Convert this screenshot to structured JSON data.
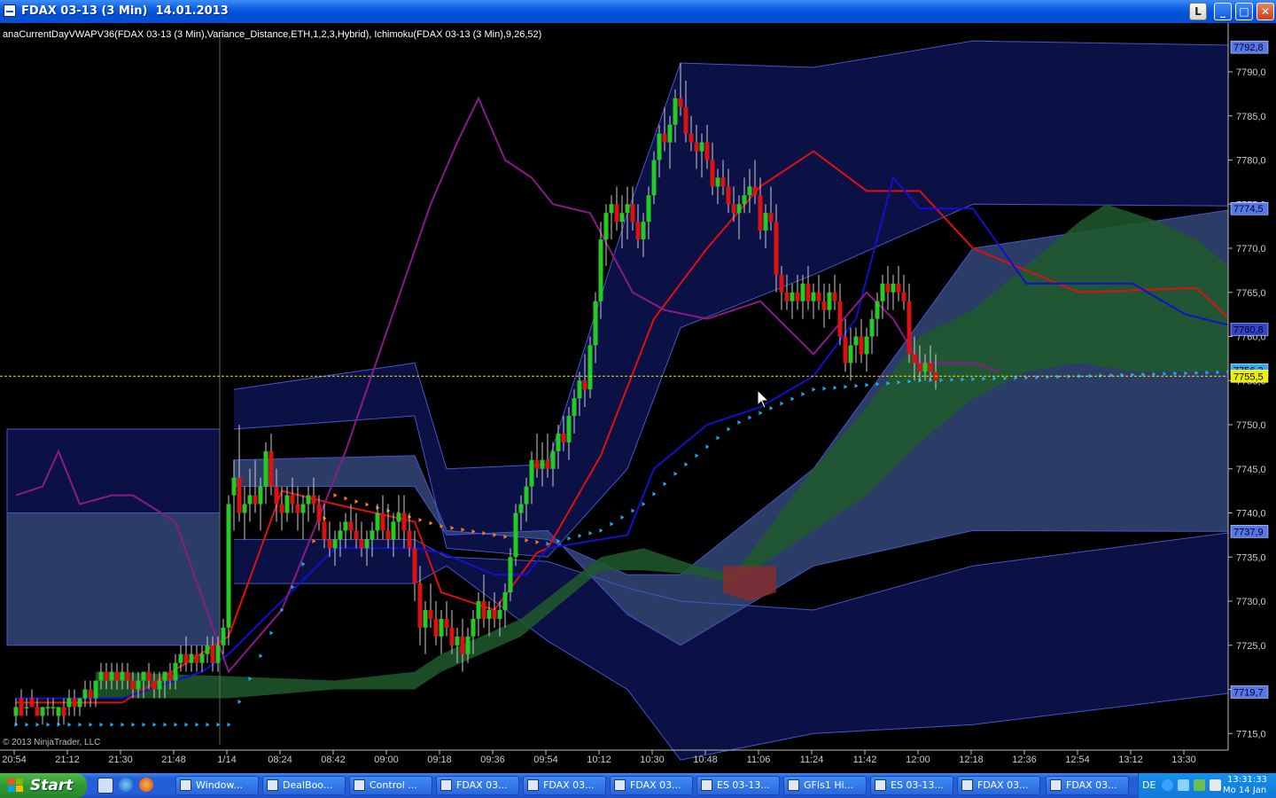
{
  "window": {
    "title": "FDAX 03-13 (3 Min)  14.01.2013",
    "buttons": {
      "link": "L",
      "minimize": "_",
      "maximize": "□",
      "close": "✕"
    }
  },
  "indicator_caption": "anaCurrentDayVWAPV36(FDAX 03-13 (3 Min),Variance_Distance,ETH,1,2,3,Hybrid),  Ichimoku(FDAX 03-13 (3 Min),9,26,52)",
  "copyright": "© 2013 NinjaTrader, LLC",
  "colors": {
    "background": "#000000",
    "vwap_band_fill": "#2b3d66",
    "outer_band_fill": "#0b1144",
    "band_edge": "#4455cc",
    "cloud_bull": "#1f5a2c",
    "cloud_bear": "#8a2c2c",
    "tenkan": "#e01010",
    "kijun": "#1010d0",
    "chikou": "#8a1a8a",
    "dots": "#22aaee",
    "dots_orange": "#ff7a20",
    "candle_up": "#22cc22",
    "candle_down": "#dd1111",
    "last_price_line": "#e6e600"
  },
  "price_axis": {
    "ticks": [
      "7790,0",
      "7785,0",
      "7780,0",
      "7775,0",
      "7770,0",
      "7765,0",
      "7760,0",
      "7755,0",
      "7750,0",
      "7745,0",
      "7740,0",
      "7735,0",
      "7730,0",
      "7725,0",
      "7720,0",
      "7715,0"
    ],
    "markers": [
      {
        "label": "7792,8",
        "value": 7792.8,
        "color": "#5577ee"
      },
      {
        "label": "7774,5",
        "value": 7774.5,
        "color": "#5577ee"
      },
      {
        "label": "7760,8",
        "value": 7760.8,
        "color": "#3344cc"
      },
      {
        "label": "7756,2",
        "value": 7756.2,
        "color": "#33aaee"
      },
      {
        "label": "7755,5",
        "value": 7755.5,
        "color": "#eeee00"
      },
      {
        "label": "7737,9",
        "value": 7737.9,
        "color": "#5577ee"
      },
      {
        "label": "7719,7",
        "value": 7719.7,
        "color": "#5577ee"
      }
    ]
  },
  "chart_data": {
    "type": "candlestick",
    "title": "FDAX 03-13 (3 Min)",
    "x_labels": [
      "20:54",
      "21:12",
      "21:30",
      "21:48",
      "1/14",
      "08:24",
      "08:42",
      "09:00",
      "09:18",
      "09:36",
      "09:54",
      "10:12",
      "10:30",
      "10:48",
      "11:06",
      "11:24",
      "11:42",
      "12:00",
      "12:18",
      "12:36",
      "12:54",
      "13:12",
      "13:30"
    ],
    "ylim": [
      7711.5,
      7794.5
    ],
    "last_price": 7755.5,
    "vwap_bands": [
      {
        "name": "session1",
        "x_range": [
          0,
          40
        ],
        "outer": [
          7749.5,
          7733.5
        ],
        "inner": [
          7740.0,
          7725.0
        ]
      },
      {
        "name": "session2",
        "x": [
          41,
          75,
          81,
          100,
          115,
          125,
          150,
          180,
          230
        ],
        "u3": [
          7754,
          7757,
          7745,
          7745.5,
          7774,
          7791,
          7790.5,
          7793.5,
          7793
        ],
        "u2": [
          7749.5,
          7751,
          7736,
          7735,
          7745,
          7761,
          7767,
          7775,
          7774.8
        ],
        "u1": [
          7746,
          7746.5,
          7738,
          7737,
          7733,
          7733,
          7745,
          7770,
          7774.5
        ],
        "l1": [
          7743,
          7743,
          7737.5,
          7738,
          7728.5,
          7725,
          7734,
          7738,
          7737.9
        ],
        "l2": [
          7737,
          7737,
          7735,
          7734.5,
          7731.5,
          7730,
          7729,
          7734,
          7737.9
        ],
        "l3": [
          7732,
          7732,
          7734,
          7725.5,
          7720,
          7712,
          7715,
          7716,
          7719.7
        ]
      }
    ],
    "candles": [
      [
        7717,
        7719,
        7716,
        7718
      ],
      [
        7719,
        7720,
        7717,
        7717
      ],
      [
        7718,
        7719,
        7717,
        7718
      ],
      [
        7719,
        7720,
        7718,
        7718
      ],
      [
        7718,
        7719,
        7717,
        7717
      ],
      [
        7717,
        7718,
        7716,
        7718
      ],
      [
        7718,
        7719,
        7717,
        7718
      ],
      [
        7718,
        7719,
        7717,
        7718
      ],
      [
        7717,
        7718,
        7716,
        7718
      ],
      [
        7718,
        7719,
        7716,
        7717
      ],
      [
        7718,
        7720,
        7717,
        7719
      ],
      [
        7719,
        7720,
        7717,
        7718
      ],
      [
        7718,
        7719,
        7717,
        7719
      ],
      [
        7719,
        7721,
        7718,
        7720
      ],
      [
        7720,
        7721,
        7718,
        7719
      ],
      [
        7719,
        7721,
        7718,
        7721
      ],
      [
        7721,
        7723,
        7720,
        7722
      ],
      [
        7722,
        7723,
        7720,
        7721
      ],
      [
        7721,
        7723,
        7720,
        7722
      ],
      [
        7722,
        7723,
        7720,
        7721
      ],
      [
        7721,
        7723,
        7720,
        7722
      ],
      [
        7722,
        7723,
        7720,
        7721
      ],
      [
        7721,
        7722,
        7719,
        7720
      ],
      [
        7720,
        7722,
        7719,
        7721
      ],
      [
        7721,
        7722,
        7719,
        7722
      ],
      [
        7722,
        7723,
        7720,
        7721
      ],
      [
        7721,
        7722,
        7719,
        7720
      ],
      [
        7720,
        7722,
        7719,
        7721
      ],
      [
        7721,
        7722,
        7719,
        7722
      ],
      [
        7722,
        7723,
        7720,
        7721
      ],
      [
        7721,
        7724,
        7720,
        7723
      ],
      [
        7723,
        7725,
        7722,
        7724
      ],
      [
        7724,
        7726,
        7722,
        7723
      ],
      [
        7723,
        7725,
        7722,
        7724
      ],
      [
        7724,
        7725,
        7722,
        7723
      ],
      [
        7723,
        7725,
        7722,
        7724
      ],
      [
        7724,
        7726,
        7723,
        7725
      ],
      [
        7725,
        7726,
        7722,
        7723
      ],
      [
        7723,
        7726,
        7722,
        7725
      ],
      [
        7725,
        7728,
        7724,
        7727
      ],
      [
        7727,
        7742,
        7725,
        7741
      ],
      [
        7742,
        7746,
        7738,
        7744
      ],
      [
        7744,
        7750,
        7739,
        7740
      ],
      [
        7740,
        7743,
        7737,
        7741
      ],
      [
        7741,
        7745,
        7739,
        7742
      ],
      [
        7742,
        7746,
        7740,
        7741
      ],
      [
        7741,
        7744,
        7738,
        7743
      ],
      [
        7743,
        7748,
        7741,
        7747
      ],
      [
        7747,
        7749,
        7742,
        7743
      ],
      [
        7743,
        7745,
        7739,
        7741
      ],
      [
        7741,
        7743,
        7738,
        7740
      ],
      [
        7740,
        7743,
        7739,
        7742
      ],
      [
        7742,
        7744,
        7740,
        7741
      ],
      [
        7741,
        7743,
        7738,
        7740
      ],
      [
        7740,
        7742,
        7737,
        7741
      ],
      [
        7741,
        7743,
        7739,
        7742
      ],
      [
        7742,
        7744,
        7740,
        7741
      ],
      [
        7741,
        7742,
        7738,
        7739
      ],
      [
        7739,
        7741,
        7736,
        7737
      ],
      [
        7737,
        7739,
        7735,
        7736
      ],
      [
        7736,
        7738,
        7734,
        7737
      ],
      [
        7737,
        7739,
        7735,
        7738
      ],
      [
        7738,
        7740,
        7736,
        7739
      ],
      [
        7739,
        7741,
        7737,
        7738
      ],
      [
        7738,
        7740,
        7736,
        7737
      ],
      [
        7737,
        7739,
        7735,
        7736
      ],
      [
        7736,
        7738,
        7734,
        7737
      ],
      [
        7737,
        7739,
        7735,
        7738
      ],
      [
        7738,
        7741,
        7737,
        7740
      ],
      [
        7740,
        7742,
        7737,
        7738
      ],
      [
        7738,
        7741,
        7736,
        7737
      ],
      [
        7737,
        7740,
        7735,
        7739
      ],
      [
        7739,
        7742,
        7737,
        7740
      ],
      [
        7740,
        7742,
        7736,
        7738
      ],
      [
        7738,
        7740,
        7735,
        7736
      ],
      [
        7736,
        7738,
        7730,
        7732
      ],
      [
        7732,
        7734,
        7725,
        7727
      ],
      [
        7727,
        7730,
        7724,
        7729
      ],
      [
        7729,
        7732,
        7727,
        7728
      ],
      [
        7728,
        7730,
        7725,
        7726
      ],
      [
        7726,
        7729,
        7724,
        7728
      ],
      [
        7728,
        7730,
        7726,
        7727
      ],
      [
        7727,
        7729,
        7724,
        7725
      ],
      [
        7725,
        7727,
        7723,
        7726
      ],
      [
        7726,
        7728,
        7722,
        7724
      ],
      [
        7724,
        7727,
        7723,
        7726
      ],
      [
        7726,
        7729,
        7724,
        7728
      ],
      [
        7728,
        7731,
        7726,
        7730
      ],
      [
        7730,
        7733,
        7727,
        7728
      ],
      [
        7728,
        7730,
        7726,
        7729
      ],
      [
        7729,
        7731,
        7727,
        7728
      ],
      [
        7728,
        7730,
        7726,
        7729
      ],
      [
        7729,
        7732,
        7727,
        7731
      ],
      [
        7731,
        7736,
        7730,
        7735
      ],
      [
        7735,
        7741,
        7734,
        7740
      ],
      [
        7740,
        7742,
        7738,
        7741
      ],
      [
        7741,
        7744,
        7739,
        7743
      ],
      [
        7743,
        7747,
        7741,
        7746
      ],
      [
        7746,
        7749,
        7744,
        7745
      ],
      [
        7745,
        7748,
        7743,
        7746
      ],
      [
        7746,
        7749,
        7744,
        7745
      ],
      [
        7745,
        7748,
        7743,
        7747
      ],
      [
        7747,
        7750,
        7745,
        7749
      ],
      [
        7749,
        7751,
        7747,
        7748
      ],
      [
        7748,
        7752,
        7746,
        7751
      ],
      [
        7751,
        7754,
        7749,
        7753
      ],
      [
        7753,
        7756,
        7751,
        7755
      ],
      [
        7755,
        7758,
        7752,
        7754
      ],
      [
        7754,
        7760,
        7753,
        7759
      ],
      [
        7759,
        7765,
        7757,
        7764
      ],
      [
        7764,
        7773,
        7762,
        7771
      ],
      [
        7771,
        7775,
        7768,
        7774
      ],
      [
        7774,
        7776,
        7771,
        7775
      ],
      [
        7775,
        7777,
        7772,
        7773
      ],
      [
        7773,
        7776,
        7770,
        7774
      ],
      [
        7774,
        7777,
        7771,
        7775
      ],
      [
        7775,
        7777,
        7772,
        7773
      ],
      [
        7773,
        7775,
        7770,
        7771
      ],
      [
        7771,
        7774,
        7769,
        7773
      ],
      [
        7773,
        7777,
        7771,
        7776
      ],
      [
        7776,
        7781,
        7775,
        7780
      ],
      [
        7780,
        7784,
        7778,
        7783
      ],
      [
        7783,
        7786,
        7781,
        7782
      ],
      [
        7782,
        7785,
        7779,
        7784
      ],
      [
        7784,
        7788,
        7782,
        7787
      ],
      [
        7787,
        7791,
        7785,
        7786
      ],
      [
        7786,
        7789,
        7782,
        7783
      ],
      [
        7783,
        7785,
        7781,
        7782
      ],
      [
        7782,
        7784,
        7779,
        7781
      ],
      [
        7781,
        7783,
        7778,
        7782
      ],
      [
        7782,
        7784,
        7779,
        7780
      ],
      [
        7780,
        7782,
        7776,
        7777
      ],
      [
        7777,
        7779,
        7775,
        7778
      ],
      [
        7778,
        7780,
        7776,
        7777
      ],
      [
        7777,
        7779,
        7774,
        7775
      ],
      [
        7775,
        7777,
        7773,
        7774
      ],
      [
        7774,
        7776,
        7771,
        7775
      ],
      [
        7775,
        7778,
        7774,
        7776
      ],
      [
        7776,
        7779,
        7774,
        7777
      ],
      [
        7777,
        7780,
        7775,
        7776
      ],
      [
        7776,
        7778,
        7771,
        7772
      ],
      [
        7772,
        7775,
        7770,
        7774
      ],
      [
        7774,
        7777,
        7772,
        7773
      ],
      [
        7773,
        7775,
        7765,
        7767
      ],
      [
        7767,
        7768,
        7763,
        7765
      ],
      [
        7765,
        7767,
        7763,
        7764
      ],
      [
        7764,
        7766,
        7762,
        7765
      ],
      [
        7765,
        7767,
        7763,
        7764
      ],
      [
        7764,
        7767,
        7762,
        7766
      ],
      [
        7766,
        7768,
        7763,
        7764
      ],
      [
        7764,
        7766,
        7762,
        7765
      ],
      [
        7765,
        7767,
        7763,
        7764
      ],
      [
        7764,
        7766,
        7761,
        7763
      ],
      [
        7763,
        7766,
        7762,
        7765
      ],
      [
        7765,
        7767,
        7763,
        7764
      ],
      [
        7764,
        7766,
        7759,
        7760
      ],
      [
        7760,
        7762,
        7756,
        7757
      ],
      [
        7757,
        7761,
        7755,
        7759
      ],
      [
        7759,
        7761,
        7757,
        7760
      ],
      [
        7760,
        7762,
        7757,
        7758
      ],
      [
        7758,
        7761,
        7756,
        7760
      ],
      [
        7760,
        7763,
        7758,
        7762
      ],
      [
        7762,
        7765,
        7760,
        7764
      ],
      [
        7764,
        7767,
        7762,
        7766
      ],
      [
        7766,
        7768,
        7763,
        7765
      ],
      [
        7765,
        7767,
        7763,
        7766
      ],
      [
        7766,
        7768,
        7764,
        7765
      ],
      [
        7765,
        7767,
        7763,
        7764
      ],
      [
        7764,
        7766,
        7757,
        7758
      ],
      [
        7758,
        7760,
        7755,
        7757
      ],
      [
        7757,
        7759,
        7755,
        7756
      ],
      [
        7756,
        7758,
        7755,
        7757
      ],
      [
        7757,
        7759,
        7755,
        7756
      ],
      [
        7756,
        7758,
        7754,
        7755
      ]
    ],
    "series": [
      {
        "name": "Tenkan",
        "x": [
          0,
          20,
          40,
          50,
          60,
          75,
          80,
          90,
          98,
          100,
          110,
          120,
          130,
          140,
          150,
          160,
          170,
          180,
          200,
          222,
          230
        ],
        "y": [
          7718.5,
          7718.5,
          7726,
          7742.5,
          7741,
          7739,
          7731,
          7729,
          7735.5,
          7736,
          7746.5,
          7762,
          7770,
          7777,
          7781,
          7776.5,
          7776.5,
          7770,
          7765,
          7765.5,
          7761
        ]
      },
      {
        "name": "Kijun",
        "x": [
          0,
          20,
          35,
          40,
          60,
          75,
          80,
          90,
          96,
          100,
          115,
          120,
          130,
          140,
          150,
          158,
          165,
          170,
          180,
          190,
          210,
          220,
          230
        ],
        "y": [
          7719,
          7719,
          7722,
          7724,
          7736,
          7736,
          7735.5,
          7733,
          7733,
          7736,
          7737.5,
          7745,
          7750,
          7752,
          7755.5,
          7762,
          7778,
          7774.5,
          7774.5,
          7766,
          7766,
          7762.5,
          7761
        ]
      },
      {
        "name": "Chikou",
        "x": [
          0,
          5,
          8,
          12,
          18,
          22,
          30,
          40,
          50,
          62,
          78,
          83,
          87,
          92,
          97,
          101,
          108,
          116,
          122,
          130,
          140,
          150,
          160,
          165,
          170,
          175,
          180,
          185
        ],
        "y": [
          7742,
          7743,
          7747,
          7741,
          7742,
          7742,
          7739,
          7722,
          7729,
          7747,
          7775,
          7782,
          7787,
          7780,
          7778,
          7775,
          7774,
          7765,
          7763,
          7762,
          7764,
          7758,
          7765,
          7762,
          7757,
          7757,
          7757,
          7756
        ]
      }
    ],
    "dots": {
      "name": "Dots",
      "x": [
        0,
        40,
        60,
        80,
        100,
        110,
        118,
        125,
        135,
        150,
        170,
        200,
        230
      ],
      "y": [
        7716,
        7716,
        7742,
        7738.5,
        7736.5,
        7738,
        7741,
        7745,
        7750,
        7754,
        7755,
        7755.5,
        7756
      ]
    }
  },
  "taskbar": {
    "start_label": "Start",
    "tasks": [
      "Window...",
      "DealBoo...",
      "Control ...",
      "FDAX 03...",
      "FDAX 03...",
      "FDAX 03...",
      "ES 03-13...",
      "GFIs1 Hi...",
      "ES 03-13...",
      "FDAX 03...",
      "FDAX 03..."
    ],
    "lang": "DE",
    "clock_time": "13:31:33",
    "clock_date": "Mo 14 Jan"
  }
}
